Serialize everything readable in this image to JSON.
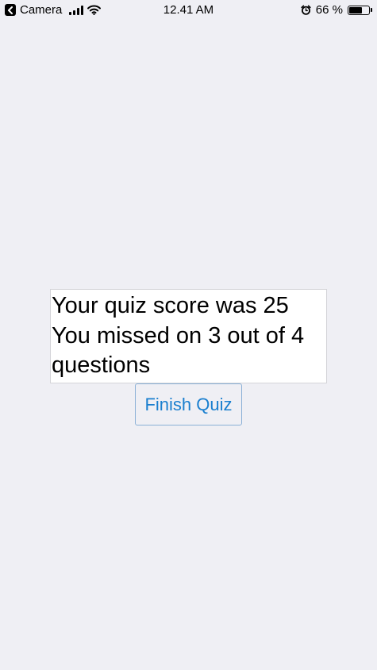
{
  "status_bar": {
    "back_app": "Camera",
    "time": "12.41 AM",
    "battery_percent": "66 %",
    "battery_level": 0.66,
    "signal_icon": "cellular-signal-icon",
    "wifi_icon": "wifi-icon",
    "alarm_icon": "alarm-icon",
    "battery_icon": "battery-icon"
  },
  "result": {
    "score_line": "Your quiz score was 25",
    "missed_line": "You missed on 3 out of 4",
    "missed_line_cont": "questions"
  },
  "finish_button": {
    "label": "Finish Quiz",
    "color": "#1a7fcf"
  }
}
